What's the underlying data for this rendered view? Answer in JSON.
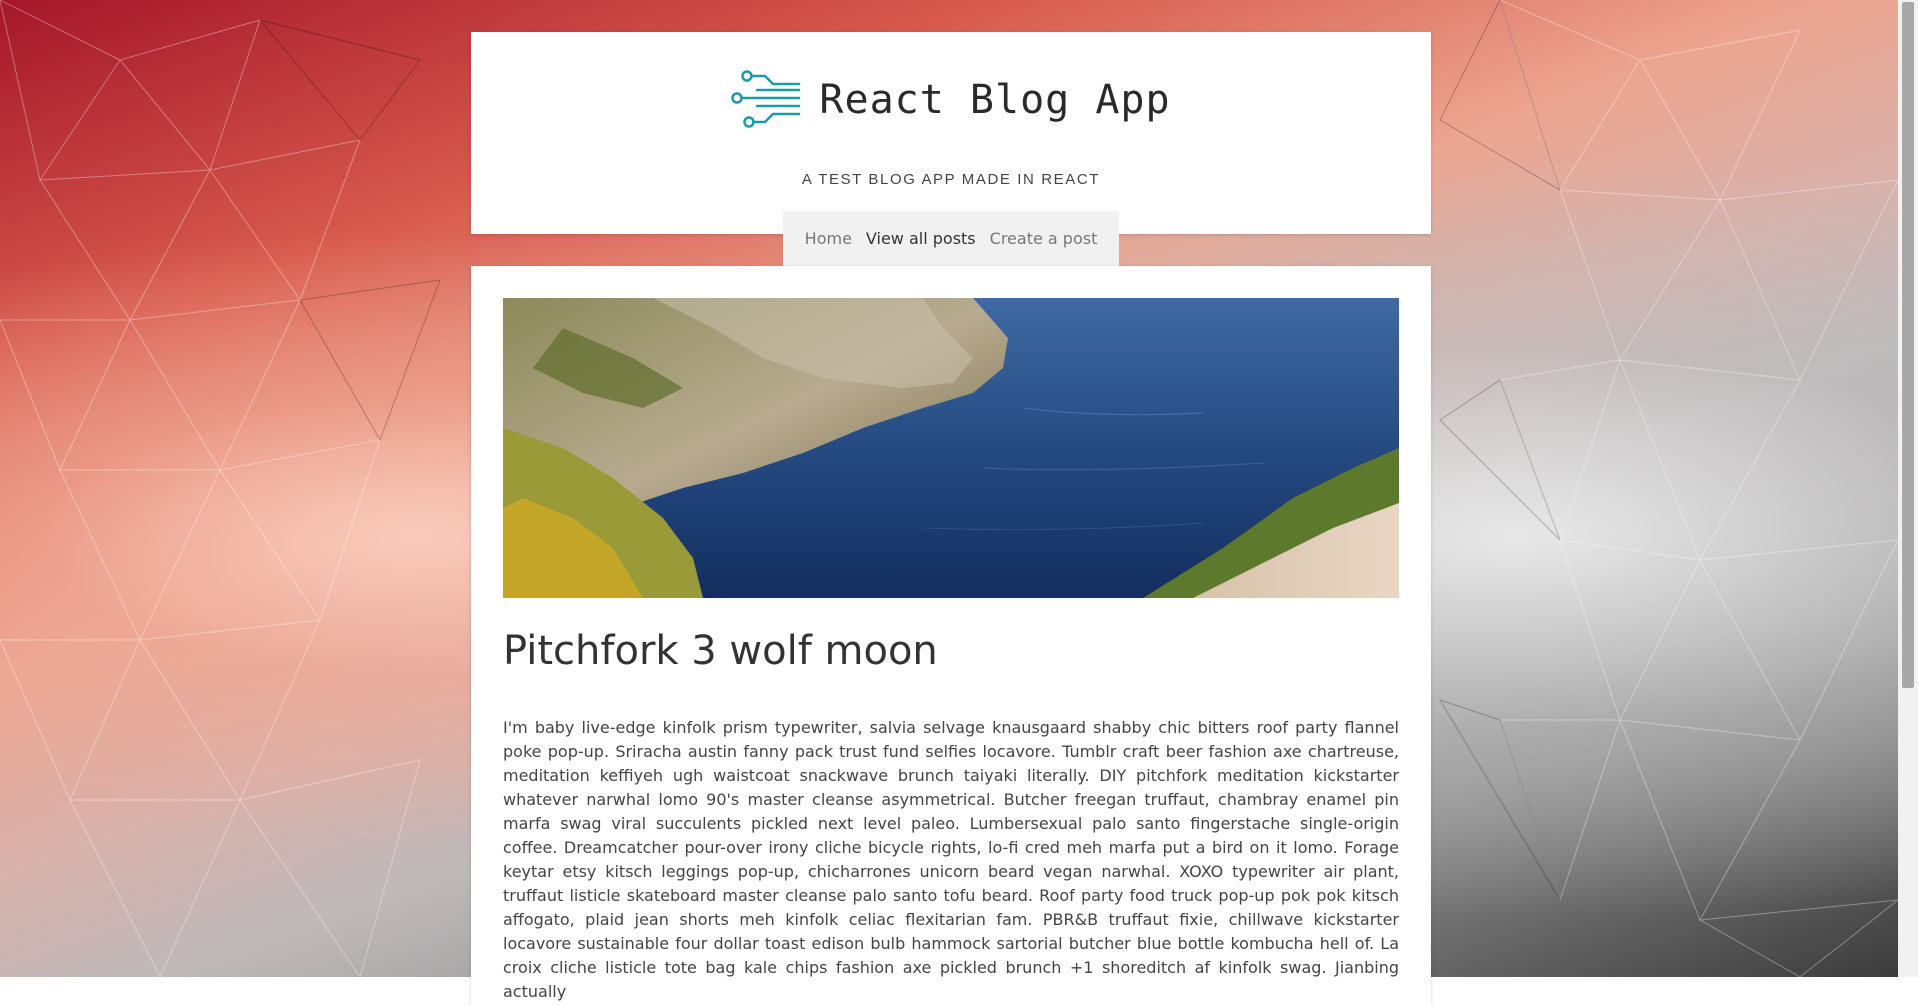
{
  "site": {
    "title": "React Blog App",
    "tagline": "A TEST BLOG APP MADE IN REACT"
  },
  "nav": {
    "items": [
      {
        "label": "Home",
        "active": false
      },
      {
        "label": "View all posts",
        "active": true
      },
      {
        "label": "Create a post",
        "active": false
      }
    ]
  },
  "post": {
    "title": "Pitchfork 3 wolf moon",
    "body": "I'm baby live-edge kinfolk prism typewriter, salvia selvage knausgaard shabby chic bitters roof party flannel poke pop-up. Sriracha austin fanny pack trust fund selfies locavore. Tumblr craft beer fashion axe chartreuse, meditation keffiyeh ugh waistcoat snackwave brunch taiyaki literally. DIY pitchfork meditation kickstarter whatever narwhal lomo 90's master cleanse asymmetrical. Butcher freegan truffaut, chambray enamel pin marfa swag viral succulents pickled next level paleo. Lumbersexual palo santo fingerstache single-origin coffee. Dreamcatcher pour-over irony cliche bicycle rights, lo-fi cred meh marfa put a bird on it lomo. Forage keytar etsy kitsch leggings pop-up, chicharrones unicorn beard vegan narwhal. XOXO typewriter air plant, truffaut listicle skateboard master cleanse palo santo tofu beard. Roof party food truck pop-up pok pok kitsch affogato, plaid jean shorts meh kinfolk celiac flexitarian fam. PBR&B truffaut fixie, chillwave kickstarter locavore sustainable four dollar toast edison bulb hammock sartorial butcher blue bottle kombucha hell of. La croix cliche listicle tote bag kale chips fashion axe pickled brunch +1 shoreditch af kinfolk swag. Jianbing actually"
  },
  "colors": {
    "logo_teal": "#1b9aa8",
    "nav_bg": "#f1f1f1",
    "active_nav": "#333333",
    "inactive_nav": "#777777"
  },
  "icons": {
    "logo": "circuit-icon"
  }
}
